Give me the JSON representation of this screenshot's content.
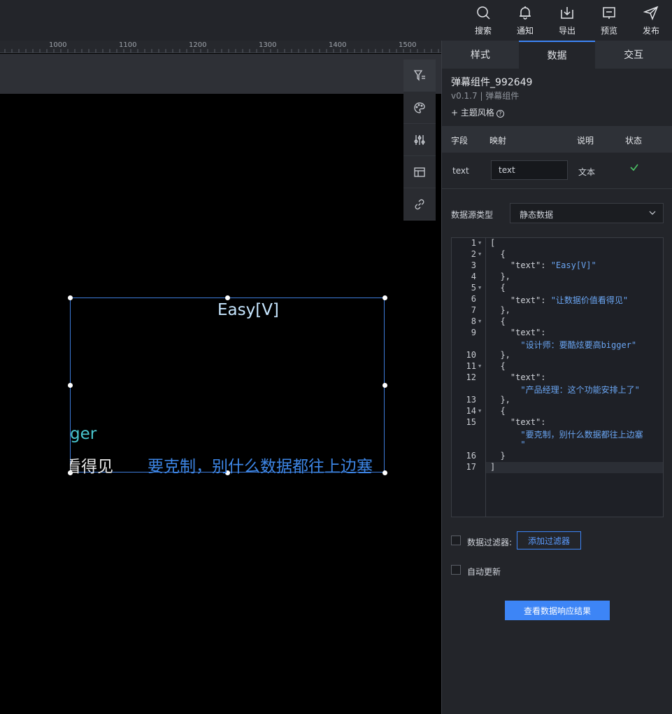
{
  "topbar": {
    "actions": [
      {
        "label": "搜索",
        "icon": "search-icon"
      },
      {
        "label": "通知",
        "icon": "bell-icon"
      },
      {
        "label": "导出",
        "icon": "export-icon"
      },
      {
        "label": "预览",
        "icon": "preview-icon"
      },
      {
        "label": "发布",
        "icon": "send-icon"
      }
    ]
  },
  "ruler": {
    "labels": [
      "1000",
      "1100",
      "1200",
      "1300",
      "1400",
      "1500"
    ]
  },
  "float_tools": [
    {
      "icon": "filter-icon"
    },
    {
      "icon": "palette-icon"
    },
    {
      "icon": "sliders-icon"
    },
    {
      "icon": "layout-icon"
    },
    {
      "icon": "link-icon"
    }
  ],
  "canvas": {
    "danmu": [
      {
        "text": "Easy[V]",
        "color": "#c7e6ff"
      },
      {
        "text": "ger",
        "color": "#49c6cf"
      },
      {
        "text": "看得见",
        "color": "#e6e6e6"
      },
      {
        "text": "要克制，别什么数据都往上边塞",
        "color": "#3d86e6"
      }
    ]
  },
  "panel": {
    "tabs": [
      {
        "label": "样式",
        "active": false
      },
      {
        "label": "数据",
        "active": true
      },
      {
        "label": "交互",
        "active": false
      }
    ],
    "component_name": "弹幕组件_992649",
    "component_version": "v0.1.7 | 弹幕组件",
    "theme_link": "+ 主题风格",
    "fields_header": {
      "field": "字段",
      "mapping": "映射",
      "desc": "说明",
      "status": "状态"
    },
    "field_row": {
      "field": "text",
      "mapping_value": "text",
      "desc": "文本"
    },
    "datasource_label": "数据源类型",
    "datasource_value": "静态数据",
    "code_lines": [
      {
        "n": "1",
        "fold": true,
        "text": "["
      },
      {
        "n": "2",
        "fold": true,
        "text": "  {"
      },
      {
        "n": "3",
        "fold": false,
        "key": "    \"text\": ",
        "str": "\"Easy[V]\""
      },
      {
        "n": "4",
        "fold": false,
        "text": "  },"
      },
      {
        "n": "5",
        "fold": true,
        "text": "  {"
      },
      {
        "n": "6",
        "fold": false,
        "key": "    \"text\": ",
        "str": "\"让数据价值看得见\""
      },
      {
        "n": "7",
        "fold": false,
        "text": "  },"
      },
      {
        "n": "8",
        "fold": true,
        "text": "  {"
      },
      {
        "n": "9",
        "fold": false,
        "key": "    \"text\":",
        "str": "",
        "wrap": "      \"设计师：要酷炫要高bigger\""
      },
      {
        "n": "10",
        "fold": false,
        "text": "  },"
      },
      {
        "n": "11",
        "fold": true,
        "text": "  {"
      },
      {
        "n": "12",
        "fold": false,
        "key": "    \"text\":",
        "str": "",
        "wrap": "      \"产品经理：这个功能安排上了\""
      },
      {
        "n": "13",
        "fold": false,
        "text": "  },"
      },
      {
        "n": "14",
        "fold": true,
        "text": "  {"
      },
      {
        "n": "15",
        "fold": false,
        "key": "    \"text\":",
        "str": "",
        "wrap": "      \"要克制，别什么数据都往上边塞",
        "wrap2": "      \""
      },
      {
        "n": "16",
        "fold": false,
        "text": "  }"
      },
      {
        "n": "17",
        "fold": false,
        "text": "]"
      }
    ],
    "filter_label": "数据过滤器:",
    "add_filter_button": "添加过滤器",
    "auto_update_label": "自动更新",
    "view_result_button": "查看数据响应结果"
  },
  "colors": {
    "accent": "#3d85f6",
    "success": "#4cc466"
  }
}
